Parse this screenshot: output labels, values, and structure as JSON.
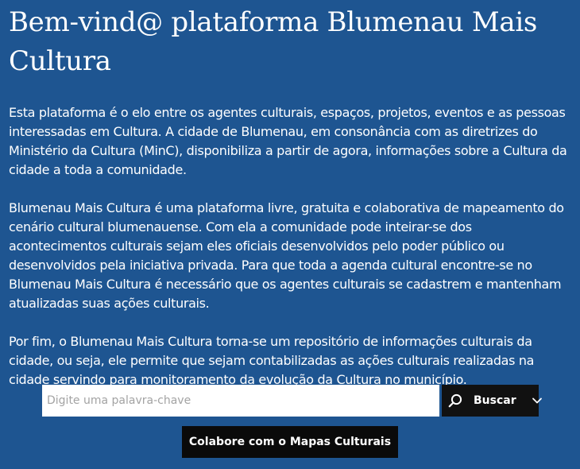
{
  "welcome": {
    "title": "Bem-vind@ plataforma Blumenau Mais Cultura",
    "paragraphs": [
      "Esta plataforma é o elo entre os agentes culturais, espaços, projetos, eventos e as pessoas interessadas em Cultura. A cidade de Blumenau, em consonância com as diretrizes do Ministério da Cultura (MinC), disponibiliza a partir de agora, informações sobre a Cultura da cidade a toda a comunidade.",
      "Blumenau Mais Cultura é uma plataforma livre, gratuita e colaborativa de mapeamento do cenário cultural blumenauense. Com ela a comunidade pode inteirar-se dos acontecimentos culturais sejam eles oficiais desenvolvidos pelo poder público ou desenvolvidos pela iniciativa privada. Para que toda a agenda cultural encontre-se no Blumenau Mais Cultura é necessário que os agentes culturais se cadastrem e mantenham atualizadas suas ações culturais.",
      "Por fim, o Blumenau Mais Cultura torna-se um repositório de informações culturais da cidade, ou seja, ele permite que sejam contabilizadas as ações culturais realizadas na cidade servindo para monitoramento da evolução da Cultura no município."
    ]
  },
  "search": {
    "placeholder": "Digite uma palavra-chave",
    "value": "",
    "button_label": "Buscar",
    "icons": {
      "search": "search-icon",
      "dropdown": "chevron-down-icon"
    }
  },
  "collaborate": {
    "label": "Colabore com o Mapas Culturais"
  },
  "colors": {
    "background": "#1e5591",
    "button": "#111111",
    "text": "#ffffff"
  }
}
